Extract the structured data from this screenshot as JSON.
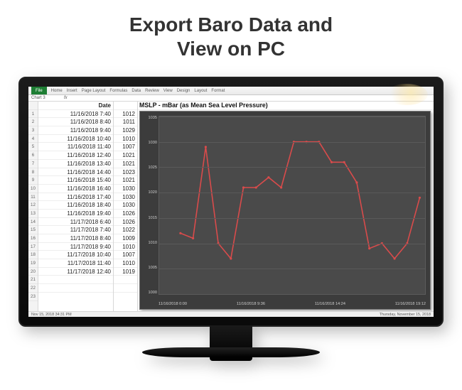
{
  "headline_line1": "Export Baro Data and",
  "headline_line2": "View on PC",
  "ribbon": {
    "file": "File",
    "tabs": [
      "Home",
      "Insert",
      "Page Layout",
      "Formulas",
      "Data",
      "Review",
      "View",
      "Design",
      "Layout",
      "Format"
    ]
  },
  "formula_bar": {
    "name_box": "Chart 3",
    "fx": "fx"
  },
  "columns": {
    "A_header": "Date",
    "B_header": "",
    "chart_header": "MSLP - mBar (as Mean Sea Level Pressure)"
  },
  "rows": [
    {
      "n": 1
    },
    {
      "n": 2,
      "date": "11/16/2018 7:40",
      "val": "1012"
    },
    {
      "n": 3,
      "date": "11/16/2018 8:40",
      "val": "1011"
    },
    {
      "n": 4,
      "date": "11/16/2018 9:40",
      "val": "1029"
    },
    {
      "n": 5,
      "date": "11/16/2018 10:40",
      "val": "1010"
    },
    {
      "n": 6,
      "date": "11/16/2018 11:40",
      "val": "1007"
    },
    {
      "n": 7,
      "date": "11/16/2018 12:40",
      "val": "1021"
    },
    {
      "n": 8,
      "date": "11/16/2018 13:40",
      "val": "1021"
    },
    {
      "n": 9,
      "date": "11/16/2018 14:40",
      "val": "1023"
    },
    {
      "n": 10,
      "date": "11/16/2018 15:40",
      "val": "1021"
    },
    {
      "n": 11,
      "date": "11/16/2018 16:40",
      "val": "1030"
    },
    {
      "n": 12,
      "date": "11/16/2018 17:40",
      "val": "1030"
    },
    {
      "n": 13,
      "date": "11/16/2018 18:40",
      "val": "1030"
    },
    {
      "n": 14,
      "date": "11/16/2018 19:40",
      "val": "1026"
    },
    {
      "n": 15,
      "date": "11/17/2018 6:40",
      "val": "1026"
    },
    {
      "n": 16,
      "date": "11/17/2018 7:40",
      "val": "1022"
    },
    {
      "n": 17,
      "date": "11/17/2018 8:40",
      "val": "1009"
    },
    {
      "n": 18,
      "date": "11/17/2018 9:40",
      "val": "1010"
    },
    {
      "n": 19,
      "date": "11/17/2018 10:40",
      "val": "1007"
    },
    {
      "n": 20,
      "date": "11/17/2018 11:40",
      "val": "1010"
    },
    {
      "n": 21,
      "date": "11/17/2018 12:40",
      "val": "1019"
    },
    {
      "n": 22,
      "date": "",
      "val": ""
    },
    {
      "n": 23,
      "date": "",
      "val": ""
    }
  ],
  "status_bar": {
    "left": "Nov 15, 2018  34:31 PM",
    "right": "Thursday, November 15, 2018"
  },
  "chart_data": {
    "type": "line",
    "title": "MSLP - mBar (as Mean Sea Level Pressure)",
    "ylabel": "",
    "xlabel": "",
    "ylim": [
      1000,
      1035
    ],
    "y_ticks": [
      1035,
      1030,
      1025,
      1020,
      1015,
      1010,
      1005,
      1000
    ],
    "x_ticks": [
      "11/16/2018 0:00",
      "11/16/2018 9:36",
      "11/16/2018 14:24",
      "11/16/2018 19:12"
    ],
    "x": [
      "11/16/2018 7:40",
      "11/16/2018 8:40",
      "11/16/2018 9:40",
      "11/16/2018 10:40",
      "11/16/2018 11:40",
      "11/16/2018 12:40",
      "11/16/2018 13:40",
      "11/16/2018 14:40",
      "11/16/2018 15:40",
      "11/16/2018 16:40",
      "11/16/2018 17:40",
      "11/16/2018 18:40",
      "11/16/2018 19:40",
      "11/17/2018 6:40",
      "11/17/2018 7:40",
      "11/17/2018 8:40",
      "11/17/2018 9:40",
      "11/17/2018 10:40",
      "11/17/2018 11:40",
      "11/17/2018 12:40"
    ],
    "values": [
      1012,
      1011,
      1029,
      1010,
      1007,
      1021,
      1021,
      1023,
      1021,
      1030,
      1030,
      1030,
      1026,
      1026,
      1022,
      1009,
      1010,
      1007,
      1010,
      1019
    ],
    "color": "#d94b4b"
  }
}
